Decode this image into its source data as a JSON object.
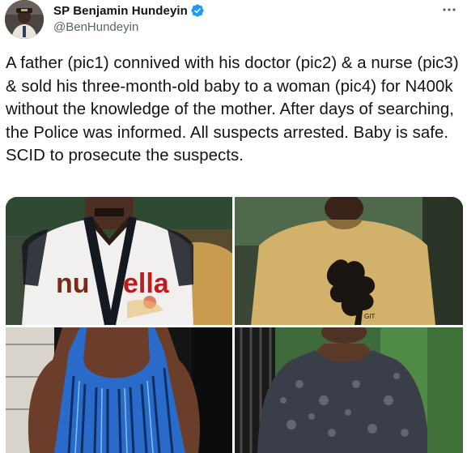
{
  "author": {
    "display_name": "SP Benjamin Hundeyin",
    "handle": "@BenHundeyin",
    "verified": true,
    "avatar_icon": "avatar-photo"
  },
  "menu": {
    "icon": "more-options-icon"
  },
  "tweet": {
    "text": "A father (pic1) connived with his doctor (pic2) & a nurse (pic3) & sold his three-month-old baby to a woman (pic4) for N400k without the knowledge of the mother. After days of searching, the Police was informed. All suspects arrested. Baby is safe. SCID to prosecute the suspects."
  },
  "media": {
    "photos": [
      {
        "label": "pic1",
        "shirt_print": "nutella"
      },
      {
        "label": "pic2"
      },
      {
        "label": "pic3"
      },
      {
        "label": "pic4"
      }
    ]
  },
  "colors": {
    "verified_badge": "#1d9bf0",
    "secondary_text": "#536471",
    "primary_text": "#0f1419"
  }
}
